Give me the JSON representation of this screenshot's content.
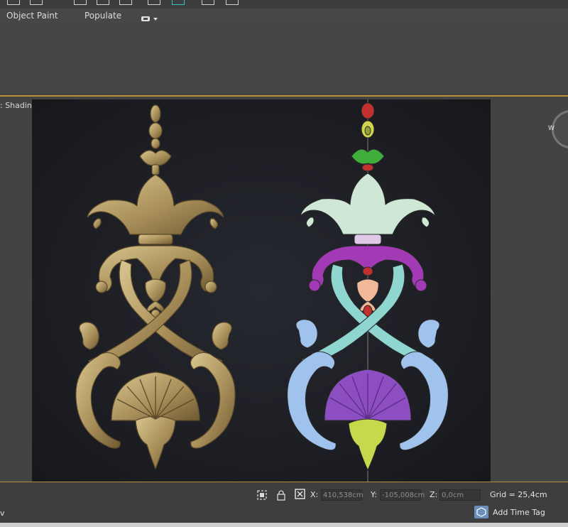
{
  "ribbon": {
    "tabs": [
      "Object Paint",
      "Populate"
    ]
  },
  "viewport": {
    "label": ": Shading ]",
    "viewcube_letter": "W"
  },
  "status": {
    "x_label": "X:",
    "x_value": "410,538cm",
    "y_label": "Y:",
    "y_value": "-105,008cm",
    "z_label": "Z:",
    "z_value": "0,0cm",
    "grid": "Grid = 25,4cm",
    "add_time_tag": "Add Time Tag",
    "left_char": "v"
  },
  "colors": {
    "accent_line": "#b7913a",
    "bronze": "#b09a66",
    "mint": "#cfe8d6",
    "magenta": "#a13ab4",
    "cyan_band": "#8ed6cf",
    "blue_scroll": "#9fc3ec",
    "purple_shell": "#8c4ec0",
    "yellow_green": "#c6d94d",
    "green_leaf": "#3fae3a",
    "red_bead": "#c2312d"
  }
}
